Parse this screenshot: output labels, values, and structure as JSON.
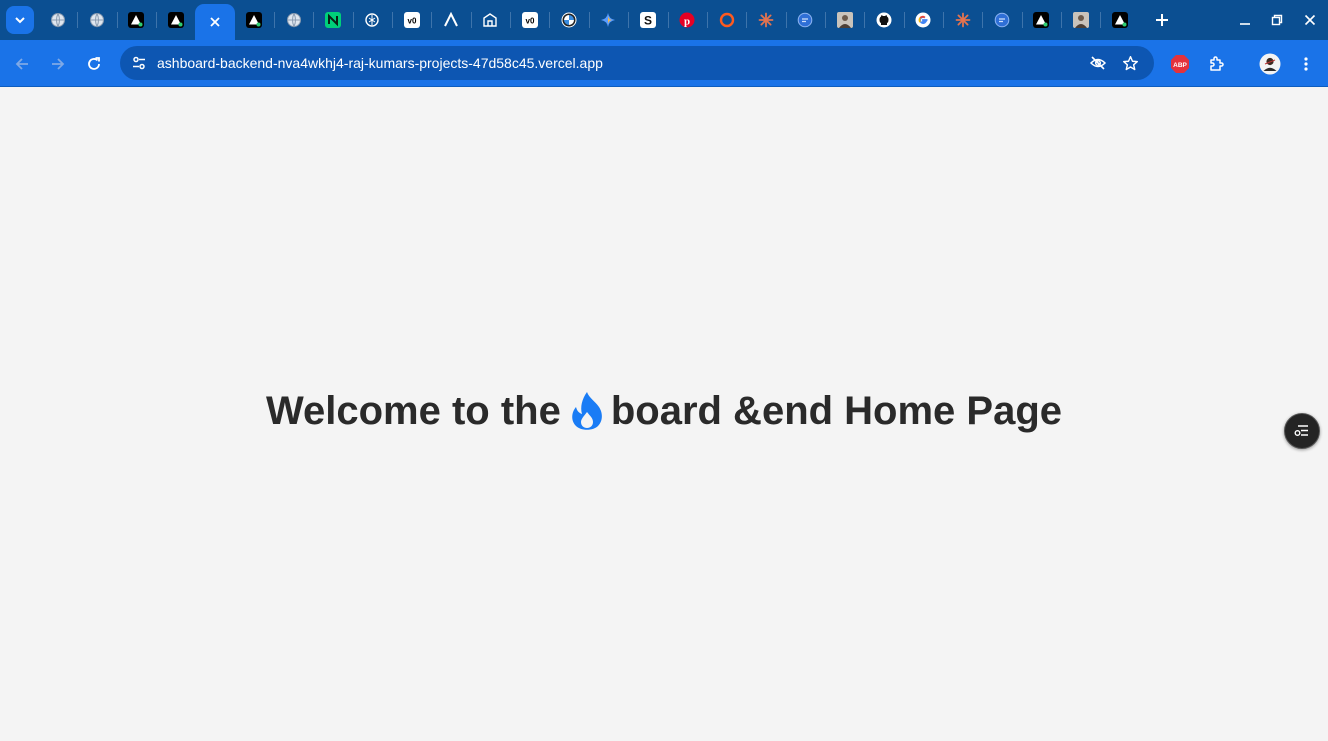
{
  "browser": {
    "address_url": "ashboard-backend-nva4wkhj4-raj-kumars-projects-47d58c45.vercel.app",
    "tabs": [
      {
        "icon": "globe-icon"
      },
      {
        "icon": "globe-icon"
      },
      {
        "icon": "triangle-logo-icon"
      },
      {
        "icon": "triangle-logo-icon"
      },
      {
        "icon": "close-icon",
        "active": true
      },
      {
        "icon": "triangle-logo-icon"
      },
      {
        "icon": "globe-icon"
      },
      {
        "icon": "n-logo-icon"
      },
      {
        "icon": "openai-icon"
      },
      {
        "icon": "v0-logo-icon"
      },
      {
        "icon": "caret-logo-icon"
      },
      {
        "icon": "building-icon"
      },
      {
        "icon": "v0-logo-icon"
      },
      {
        "icon": "bmw-logo-icon"
      },
      {
        "icon": "gemini-icon"
      },
      {
        "icon": "s-logo-icon"
      },
      {
        "icon": "pinterest-icon"
      },
      {
        "icon": "ring-icon"
      },
      {
        "icon": "claude-icon"
      },
      {
        "icon": "chat-icon"
      },
      {
        "icon": "photo-icon"
      },
      {
        "icon": "github-icon"
      },
      {
        "icon": "google-icon"
      },
      {
        "icon": "claude-icon"
      },
      {
        "icon": "chat-icon"
      },
      {
        "icon": "triangle-logo-icon"
      },
      {
        "icon": "photo-icon"
      },
      {
        "icon": "triangle-logo-icon"
      }
    ],
    "extension_badge": "ABP"
  },
  "page": {
    "heading_before": "Welcome to the",
    "heading_after": "board &end Home Page"
  },
  "colors": {
    "tabstrip": "#0b4f92",
    "toolbar": "#1a73e8",
    "omnibox": "#0d56b2",
    "page_bg": "#f4f4f4",
    "heading": "#2a2a2a",
    "flame": "#1a7cf5"
  }
}
